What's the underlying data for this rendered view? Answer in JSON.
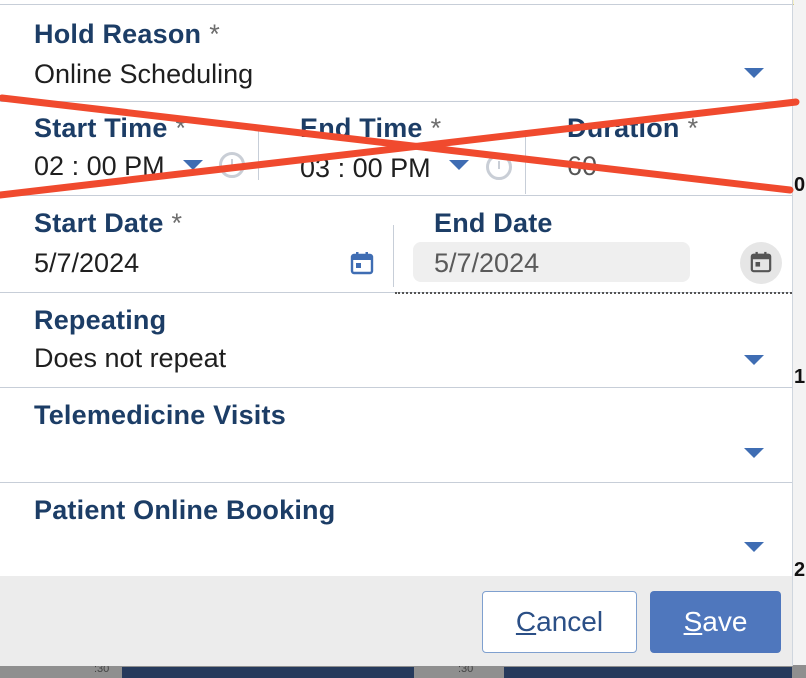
{
  "form": {
    "required_mark": "*",
    "hold_reason": {
      "label": "Hold Reason",
      "value": "Online Scheduling"
    },
    "start_time": {
      "label": "Start Time",
      "hour": "02",
      "sep": ":",
      "minute": "00",
      "ampm": "PM"
    },
    "end_time": {
      "label": "End Time",
      "hour": "03",
      "sep": ":",
      "minute": "00",
      "ampm": "PM"
    },
    "duration": {
      "label": "Duration",
      "value": "60"
    },
    "start_date": {
      "label": "Start Date",
      "value": "5/7/2024"
    },
    "end_date": {
      "label": "End Date",
      "value": "5/7/2024"
    },
    "repeating": {
      "label": "Repeating",
      "value": "Does not repeat"
    },
    "telemedicine": {
      "label": "Telemedicine Visits",
      "value": ""
    },
    "online_booking": {
      "label": "Patient Online Booking",
      "value": ""
    }
  },
  "footer": {
    "cancel": {
      "first": "C",
      "rest": "ancel"
    },
    "save": {
      "first": "S",
      "rest": "ave"
    }
  },
  "background": {
    "marks": [
      "0",
      "1",
      "2"
    ],
    "half_labels": [
      ":30",
      ":30"
    ]
  },
  "colors": {
    "label": "#1c3d66",
    "accent": "#3f6db3",
    "save": "#4f77bd",
    "annotation": "#f04a2e"
  },
  "icons": [
    "dropdown-caret-icon",
    "clock-icon",
    "calendar-icon"
  ]
}
